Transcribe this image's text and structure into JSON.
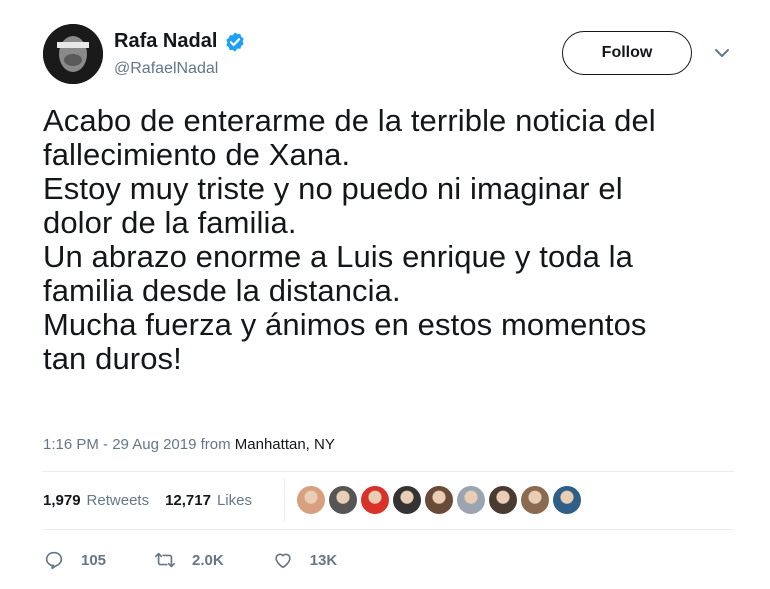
{
  "user": {
    "display_name": "Rafa Nadal",
    "handle": "@RafaelNadal",
    "verified": true
  },
  "follow_button": {
    "label": "Follow"
  },
  "tweet": {
    "lines": [
      "Acabo de enterarme de la terrible noticia del",
      "fallecimiento de Xana.",
      "Estoy muy triste y no puedo ni imaginar el",
      "dolor de la familia.",
      "Un abrazo enorme a Luis enrique y toda la",
      "familia desde la distancia.",
      "Mucha fuerza y ánimos en estos momentos",
      "tan duros!"
    ],
    "timestamp": "1:16 PM - 29 Aug 2019 from ",
    "location": "Manhattan, NY"
  },
  "stats": {
    "retweets_count": "1,979",
    "retweets_label": "Retweets",
    "likes_count": "12,717",
    "likes_label": "Likes"
  },
  "likers": [
    {
      "icon": "liker-avatar-1",
      "color": "#d8a07e"
    },
    {
      "icon": "liker-avatar-2",
      "color": "#555555"
    },
    {
      "icon": "liker-avatar-3",
      "color": "#d8322a"
    },
    {
      "icon": "liker-avatar-4",
      "color": "#333333"
    },
    {
      "icon": "liker-avatar-5",
      "color": "#6a4b3a"
    },
    {
      "icon": "liker-avatar-6",
      "color": "#9aa5b1"
    },
    {
      "icon": "liker-avatar-7",
      "color": "#4a3b30"
    },
    {
      "icon": "liker-avatar-8",
      "color": "#8a6a50"
    },
    {
      "icon": "liker-avatar-9",
      "color": "#2f5e86"
    }
  ],
  "actions": {
    "replies": "105",
    "retweets": "2.0K",
    "likes": "13K"
  },
  "colors": {
    "text": "#14171a",
    "secondary": "#657786",
    "verified": "#1da1f2",
    "divider": "#e6ecf0"
  }
}
